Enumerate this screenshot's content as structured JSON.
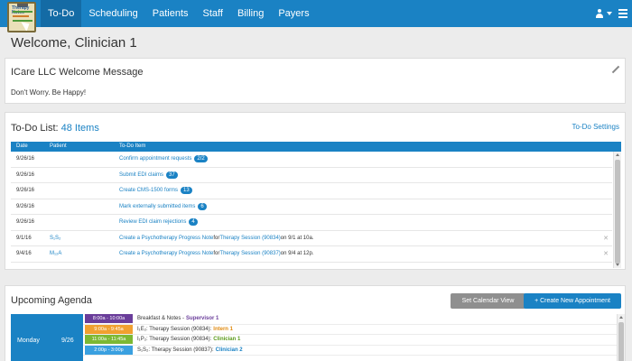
{
  "nav": {
    "items": [
      {
        "label": "To-Do",
        "active": true
      },
      {
        "label": "Scheduling",
        "active": false
      },
      {
        "label": "Patients",
        "active": false
      },
      {
        "label": "Staff",
        "active": false
      },
      {
        "label": "Billing",
        "active": false
      },
      {
        "label": "Payers",
        "active": false
      }
    ],
    "logo_text": "Therapy Notes",
    "user_icon": "user-icon",
    "brand_color": "#1a82c4"
  },
  "welcome": "Welcome, Clinician 1",
  "message": {
    "title": "ICare LLC Welcome Message",
    "body": "Don't Worry. Be Happy!"
  },
  "todo": {
    "title_prefix": "To-Do List: ",
    "count_label": "48 Items",
    "settings_label": "To-Do Settings",
    "columns": [
      "Date",
      "Patient",
      "To-Do Item"
    ],
    "rows": [
      {
        "date": "9/26/16",
        "patient": "",
        "item": "Confirm appointment requests",
        "suffix": "",
        "badge": "2/2"
      },
      {
        "date": "9/26/16",
        "patient": "",
        "item": "Submit EDI claims",
        "suffix": "",
        "badge": "37"
      },
      {
        "date": "9/26/16",
        "patient": "",
        "item": "Create CMS-1500 forms",
        "suffix": "",
        "badge": "13"
      },
      {
        "date": "9/26/16",
        "patient": "",
        "item": "Mark externally submitted items",
        "suffix": "",
        "badge": "6"
      },
      {
        "date": "9/26/16",
        "patient": "",
        "item": "Review EDI claim rejections",
        "suffix": "",
        "badge": "4"
      },
      {
        "date": "9/1/16",
        "patient": "S₁S₂",
        "item": "Create a Psychotherapy Progress Note",
        "mid": " for ",
        "item2": "Therapy Session (90834)",
        "tail": " on 9/1 at 10a.",
        "badge": ""
      },
      {
        "date": "9/4/16",
        "patient": "M₁₂A",
        "item": "Create a Psychotherapy Progress Note",
        "mid": " for ",
        "item2": "Therapy Session (90837)",
        "tail": " on 9/4 at 12p.",
        "badge": ""
      }
    ]
  },
  "agenda": {
    "title": "Upcoming Agenda",
    "calendar_button": "Set Calendar View",
    "new_button": "+ Create New Appointment",
    "day_name": "Monday",
    "day_date": "9/26",
    "appointments": [
      {
        "time": "8:00a - 10:00a",
        "color": "#6a3d9a",
        "desc": "Breakfast & Notes - ",
        "who": "Supervisor 1",
        "who_color": "#6a3d9a"
      },
      {
        "time": "9:00a - 9:45a",
        "color": "#f0a030",
        "desc": "I₁E₂: Therapy Session (90834): ",
        "who": "Intern 1",
        "who_color": "#e08a10"
      },
      {
        "time": "11:00a - 11:45a",
        "color": "#7cb833",
        "desc": "I₁P₂: Therapy Session (90834): ",
        "who": "Clinician 1",
        "who_color": "#5a9a1a"
      },
      {
        "time": "2:00p - 3:00p",
        "color": "#3aa0e0",
        "desc": "S₁S₂: Therapy Session (90837): ",
        "who": "Clinician 2",
        "who_color": "#1a82c4"
      }
    ]
  }
}
